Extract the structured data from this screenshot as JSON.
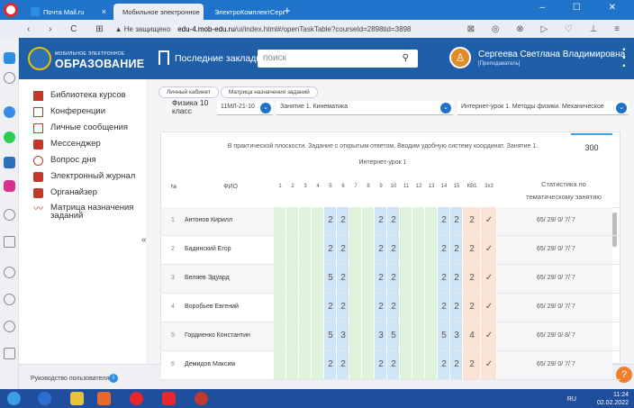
{
  "browser": {
    "tabs": [
      {
        "label": "Почта Mail.ru"
      },
      {
        "label": "Мобильное электронное"
      },
      {
        "label": "ЭлектроКомплектСервис"
      }
    ],
    "new_tab": "+",
    "window_buttons": "‒ ☐ ✕",
    "nav": "‹ › C ⊞",
    "secure": "▲ Не защищено",
    "url_host": "edu-4.mob-edu.ru",
    "url_path": "/ui/index.html#/openTaskTable?courseId=2898tid=3898",
    "tools": "⊠ ◎ ⊗ ▷ ♡ ⊥ ≡"
  },
  "header": {
    "logo_small": "МОБИЛЬНОЕ ЭЛЕКТРОННОЕ",
    "logo_big": "ОБРАЗОВАНИЕ",
    "bookmarks": "Последние закладки",
    "search_placeholder": "поиск",
    "user_name": "Сергеева Светлана Владимировна",
    "user_role": "[Преподаватель]"
  },
  "sidebar": {
    "items": [
      {
        "label": "Библиотека курсов",
        "icon": "library-icon"
      },
      {
        "label": "Конференции",
        "icon": "conference-icon"
      },
      {
        "label": "Личные сообщения",
        "icon": "mail-icon"
      },
      {
        "label": "Мессенджер",
        "icon": "messenger-icon"
      },
      {
        "label": "Вопрос дня",
        "icon": "question-icon"
      },
      {
        "label": "Электронный журнал",
        "icon": "journal-icon"
      },
      {
        "label": "Органайзер",
        "icon": "organizer-icon"
      },
      {
        "label": "Матрица назначения заданий",
        "icon": "matrix-icon"
      }
    ],
    "collapse": "«"
  },
  "breadcrumb": [
    "Личный кабинет",
    "Матрица назначения заданий"
  ],
  "subject": "Физика 10 класс",
  "selects": {
    "group": "11МЛ-21-10",
    "lesson": "Занятие 1. Кинематика",
    "topic": "Интернет-урок 1. Методы физики. Механическое"
  },
  "task": {
    "text": "В практической плоскости. Задание с открытым ответом. Вводим удобную систему координат. Занятие 1.",
    "lesson_name": "Интернет-урок 1",
    "points": "300"
  },
  "table": {
    "col_num": "№",
    "col_fio": "ФИО",
    "task_cols": [
      "1",
      "2",
      "3",
      "4",
      "5",
      "6",
      "7",
      "8",
      "9",
      "10",
      "11",
      "12",
      "13",
      "14",
      "15",
      "КВ1",
      "3х3"
    ],
    "col_stat": "Статистика по тематическому занятию",
    "rows": [
      {
        "n": "1",
        "fio": "Антонов Кирилл",
        "v5": "2",
        "v6": "2",
        "v9": "2",
        "v10": "2",
        "v14": "2",
        "v15": "2",
        "kv1": "2",
        "x3": "✓",
        "stat": "65/ 29/ 0/ 7/ 7"
      },
      {
        "n": "2",
        "fio": "Бадинский Егор",
        "v5": "2",
        "v6": "2",
        "v9": "2",
        "v10": "2",
        "v14": "2",
        "v15": "2",
        "kv1": "2",
        "x3": "✓",
        "stat": "65/ 29/ 0/ 7/ 7"
      },
      {
        "n": "3",
        "fio": "Беляев Эдуард",
        "v5": "5",
        "v6": "2",
        "v9": "2",
        "v10": "2",
        "v14": "2",
        "v15": "2",
        "kv1": "2",
        "x3": "✓",
        "stat": "65/ 29/ 0/ 7/ 7"
      },
      {
        "n": "4",
        "fio": "Воробьев Евгений",
        "v5": "2",
        "v6": "2",
        "v9": "2",
        "v10": "2",
        "v14": "2",
        "v15": "2",
        "kv1": "2",
        "x3": "✓",
        "stat": "65/ 29/ 0/ 7/ 7"
      },
      {
        "n": "5",
        "fio": "Гордиенко Константин",
        "v5": "5",
        "v6": "3",
        "v9": "3",
        "v10": "5",
        "v14": "5",
        "v15": "3",
        "kv1": "4",
        "x3": "✓",
        "stat": "65/ 29/ 0/ 8/ 7"
      },
      {
        "n": "6",
        "fio": "Демидов Максим",
        "v5": "2",
        "v6": "2",
        "v9": "2",
        "v10": "2",
        "v14": "2",
        "v15": "2",
        "kv1": "2",
        "x3": "✓",
        "stat": "65/ 29/ 0/ 7/ 7"
      }
    ]
  },
  "footer": {
    "guide": "Руководство пользователя",
    "info": "i",
    "help": "?"
  },
  "taskbar": {
    "lang": "RU",
    "time": "11:24",
    "date": "02.02.2022"
  }
}
